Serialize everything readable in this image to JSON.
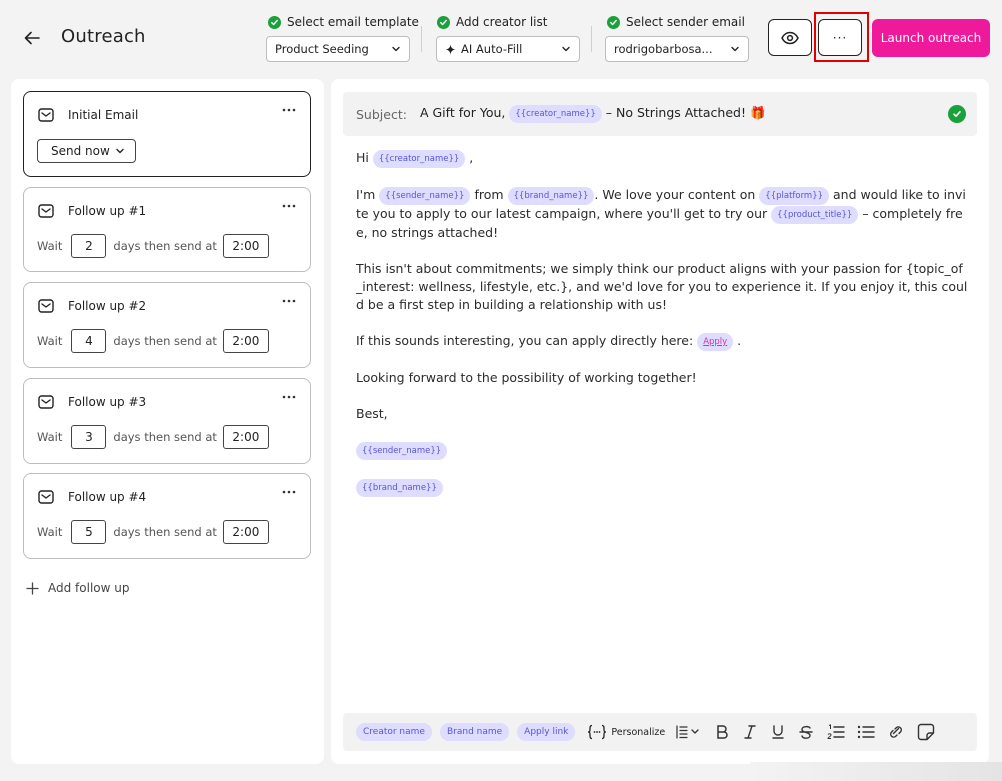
{
  "header": {
    "title": "Outreach",
    "steps": [
      {
        "label": "Select email template",
        "value": "Product Seeding"
      },
      {
        "label": "Add creator list",
        "value": "AI Auto-Fill",
        "prefix_icon": "sparkle-icon"
      },
      {
        "label": "Select sender email",
        "value": "rodrigobarbosa..."
      }
    ],
    "launch_label": "Launch outreach",
    "more_label": "···"
  },
  "sequence": {
    "initial": {
      "title": "Initial Email",
      "send_option": "Send now"
    },
    "follow_ups": [
      {
        "title": "Follow up #1",
        "wait_label": "Wait",
        "days": "2",
        "mid_label": "days then send at",
        "time": "2:00"
      },
      {
        "title": "Follow up #2",
        "wait_label": "Wait",
        "days": "4",
        "mid_label": "days then send at",
        "time": "2:00"
      },
      {
        "title": "Follow up #3",
        "wait_label": "Wait",
        "days": "3",
        "mid_label": "days then send at",
        "time": "2:00"
      },
      {
        "title": "Follow up #4",
        "wait_label": "Wait",
        "days": "5",
        "mid_label": "days then send at",
        "time": "2:00"
      }
    ],
    "add_label": "Add follow up"
  },
  "email": {
    "subject_label": "Subject:",
    "subject_pre": "A Gift for You,",
    "subject_tag": "{{creator_name}}",
    "subject_post": "– No Strings Attached! 🎁",
    "greeting_pre": "Hi",
    "greeting_tag": "{{creator_name}}",
    "greeting_post": ",",
    "p1_a": "I'm",
    "p1_tag1": "{{sender_name}}",
    "p1_b": "from",
    "p1_tag2": "{{brand_name}}",
    "p1_c": ". We love your content on",
    "p1_tag3": "{{platform}}",
    "p1_d": "and would like to invite you to apply to our latest campaign, where you'll get to try our",
    "p1_tag4": "{{product_title}}",
    "p1_e": "– completely free, no strings attached!",
    "p2": "This isn't about commitments; we simply think our product aligns with your passion for {topic_of_interest: wellness, lifestyle, etc.}, and we'd love for you to experience it. If you enjoy it, this could be a first step in building a relationship with us!",
    "p3_pre": "If this sounds interesting, you can apply directly here:",
    "p3_link": "Apply",
    "p3_post": ".",
    "p4": "Looking forward to the possibility of working together!",
    "signoff": "Best,",
    "sig_tag1": "{{sender_name}}",
    "sig_tag2": "{{brand_name}}"
  },
  "toolbar": {
    "tag1": "Creator name",
    "tag2": "Brand name",
    "tag3": "Apply link",
    "personalize_label": "Personalize"
  },
  "colors": {
    "accent": "#ee1a9b",
    "check": "#1aa13b",
    "tag_bg": "#dedcff",
    "tag_text": "#5856d6",
    "highlight": "#e00000"
  }
}
